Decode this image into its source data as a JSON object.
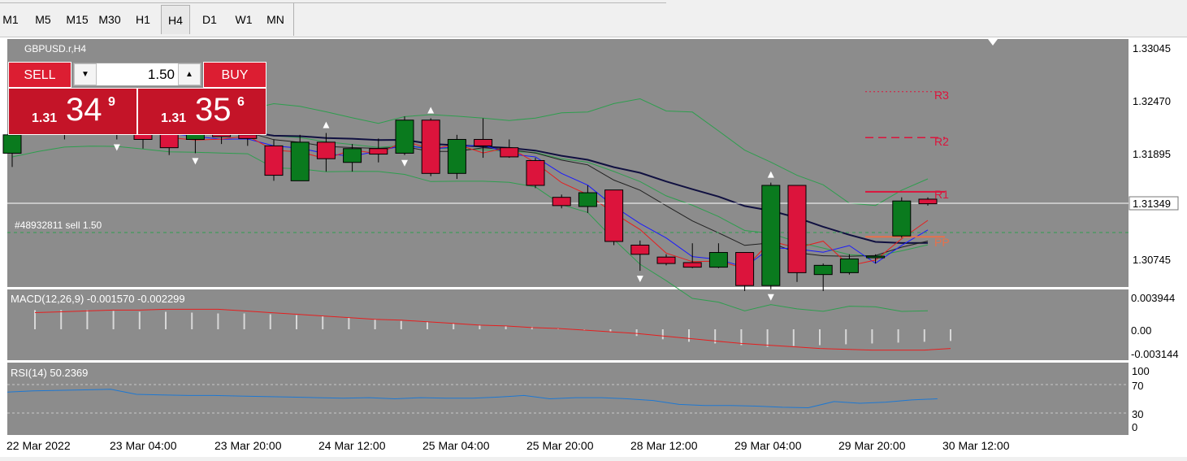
{
  "toolbar": {
    "timeframes": [
      "M1",
      "M5",
      "M15",
      "M30",
      "H1",
      "H4",
      "D1",
      "W1",
      "MN"
    ],
    "active": "H4"
  },
  "chart": {
    "symbol_label": "GBPUSD.r,H4",
    "order_label": "#48932811 sell 1.50",
    "price_axis": [
      "1.33045",
      "1.32470",
      "1.31895",
      "1.31349",
      "1.30745"
    ],
    "current_price": "1.31349",
    "pivot_labels": [
      "R3",
      "R2",
      "R1",
      "PP"
    ],
    "time_axis": [
      "22 Mar 2022",
      "23 Mar 04:00",
      "23 Mar 20:00",
      "24 Mar 12:00",
      "25 Mar 04:00",
      "25 Mar 20:00",
      "28 Mar 12:00",
      "29 Mar 04:00",
      "29 Mar 20:00",
      "30 Mar 12:00"
    ],
    "colors": {
      "background": "#8c8c8c",
      "bull": "#0a7a1e",
      "bear": "#dc143c",
      "grid": "#b4b4b4",
      "bollinger": "#2e9e4e",
      "ma_fast": "#1a1aff",
      "ma_slow": "#101040",
      "ma_red": "#e61e1e"
    },
    "candles": [
      {
        "o": 1.319,
        "h": 1.3215,
        "l": 1.3175,
        "c": 1.321
      },
      {
        "o": 1.3235,
        "h": 1.324,
        "l": 1.3215,
        "c": 1.3222
      },
      {
        "o": 1.3225,
        "h": 1.3245,
        "l": 1.3205,
        "c": 1.323
      },
      {
        "o": 1.324,
        "h": 1.325,
        "l": 1.3215,
        "c": 1.3225
      },
      {
        "o": 1.3232,
        "h": 1.3245,
        "l": 1.3205,
        "c": 1.322
      },
      {
        "o": 1.3215,
        "h": 1.323,
        "l": 1.3195,
        "c": 1.3205
      },
      {
        "o": 1.3212,
        "h": 1.3218,
        "l": 1.3188,
        "c": 1.3196
      },
      {
        "o": 1.3205,
        "h": 1.3215,
        "l": 1.319,
        "c": 1.3212
      },
      {
        "o": 1.3215,
        "h": 1.3225,
        "l": 1.32,
        "c": 1.3208
      },
      {
        "o": 1.321,
        "h": 1.322,
        "l": 1.3198,
        "c": 1.3206
      },
      {
        "o": 1.3198,
        "h": 1.3205,
        "l": 1.316,
        "c": 1.3166
      },
      {
        "o": 1.316,
        "h": 1.321,
        "l": 1.316,
        "c": 1.3202
      },
      {
        "o": 1.3202,
        "h": 1.3212,
        "l": 1.317,
        "c": 1.3184
      },
      {
        "o": 1.318,
        "h": 1.32,
        "l": 1.317,
        "c": 1.3195
      },
      {
        "o": 1.3195,
        "h": 1.3206,
        "l": 1.318,
        "c": 1.3189
      },
      {
        "o": 1.319,
        "h": 1.323,
        "l": 1.3188,
        "c": 1.3226
      },
      {
        "o": 1.3226,
        "h": 1.3228,
        "l": 1.3165,
        "c": 1.3168
      },
      {
        "o": 1.3168,
        "h": 1.321,
        "l": 1.3162,
        "c": 1.3205
      },
      {
        "o": 1.3205,
        "h": 1.3228,
        "l": 1.3185,
        "c": 1.3198
      },
      {
        "o": 1.3196,
        "h": 1.3205,
        "l": 1.3185,
        "c": 1.3186
      },
      {
        "o": 1.3182,
        "h": 1.3185,
        "l": 1.3152,
        "c": 1.3155
      },
      {
        "o": 1.3142,
        "h": 1.3145,
        "l": 1.313,
        "c": 1.3133
      },
      {
        "o": 1.3132,
        "h": 1.3155,
        "l": 1.3125,
        "c": 1.3147
      },
      {
        "o": 1.315,
        "h": 1.315,
        "l": 1.309,
        "c": 1.3094
      },
      {
        "o": 1.309,
        "h": 1.3095,
        "l": 1.3062,
        "c": 1.308
      },
      {
        "o": 1.3077,
        "h": 1.308,
        "l": 1.3068,
        "c": 1.307
      },
      {
        "o": 1.3071,
        "h": 1.3092,
        "l": 1.3065,
        "c": 1.3066
      },
      {
        "o": 1.3066,
        "h": 1.3092,
        "l": 1.3065,
        "c": 1.3082
      },
      {
        "o": 1.3082,
        "h": 1.3082,
        "l": 1.304,
        "c": 1.3046
      },
      {
        "o": 1.3046,
        "h": 1.3158,
        "l": 1.3042,
        "c": 1.3155
      },
      {
        "o": 1.3155,
        "h": 1.3155,
        "l": 1.305,
        "c": 1.306
      },
      {
        "o": 1.3058,
        "h": 1.307,
        "l": 1.304,
        "c": 1.3068
      },
      {
        "o": 1.306,
        "h": 1.308,
        "l": 1.3058,
        "c": 1.3075
      },
      {
        "o": 1.3077,
        "h": 1.308,
        "l": 1.307,
        "c": 1.3078
      },
      {
        "o": 1.31,
        "h": 1.3142,
        "l": 1.3098,
        "c": 1.3138
      },
      {
        "o": 1.314,
        "h": 1.3142,
        "l": 1.3133,
        "c": 1.3135
      }
    ],
    "pivots": {
      "r3": 1.3257,
      "r2": 1.3207,
      "r1": 1.3148,
      "pp": 1.3099
    }
  },
  "trade": {
    "sell_label": "SELL",
    "buy_label": "BUY",
    "volume": "1.50",
    "sell_small": "1.31",
    "sell_big": "34",
    "sell_sup": "9",
    "buy_small": "1.31",
    "buy_big": "35",
    "buy_sup": "6"
  },
  "macd": {
    "label": "MACD(12,26,9) -0.001570 -0.002299",
    "axis": [
      "0.003944",
      "0.00",
      "-0.003144"
    ],
    "hist": [
      0.0023,
      0.0023,
      0.0023,
      0.0022,
      0.0021,
      0.0021,
      0.002,
      0.0019,
      0.0019,
      0.0018,
      0.0017,
      0.0016,
      0.0014,
      0.0012,
      0.001,
      0.0009,
      0.0007,
      0.0005,
      0.0004,
      0.0003,
      0.0001,
      -0.0001,
      -0.0003,
      -0.0008,
      -0.0012,
      -0.0015,
      -0.0017,
      -0.0019,
      -0.0021,
      -0.002,
      -0.0019,
      -0.0018,
      -0.0017,
      -0.0016,
      -0.0015,
      -0.0014
    ],
    "signal": [
      0.002,
      0.0021,
      0.0022,
      0.0023,
      0.0023,
      0.0024,
      0.0024,
      0.0024,
      0.0022,
      0.002,
      0.0018,
      0.0016,
      0.0014,
      0.0012,
      0.0011,
      0.0009,
      0.0007,
      0.0005,
      0.0004,
      0.0002,
      0.0001,
      -0.0001,
      -0.0003,
      -0.0005,
      -0.0008,
      -0.0011,
      -0.0014,
      -0.0017,
      -0.0019,
      -0.0021,
      -0.0023,
      -0.0024,
      -0.0025,
      -0.0025,
      -0.0025,
      -0.0023
    ]
  },
  "rsi": {
    "label": "RSI(14) 50.2369",
    "axis": [
      "100",
      "70",
      "30",
      "0"
    ],
    "values": [
      62,
      64,
      65,
      66,
      67,
      58,
      57,
      56,
      56,
      55,
      54,
      53,
      52,
      51,
      52,
      50,
      52,
      51,
      51,
      53,
      56,
      50,
      52,
      52,
      50,
      47,
      40,
      38,
      38,
      37,
      35,
      34,
      45,
      42,
      44,
      48,
      50
    ]
  }
}
